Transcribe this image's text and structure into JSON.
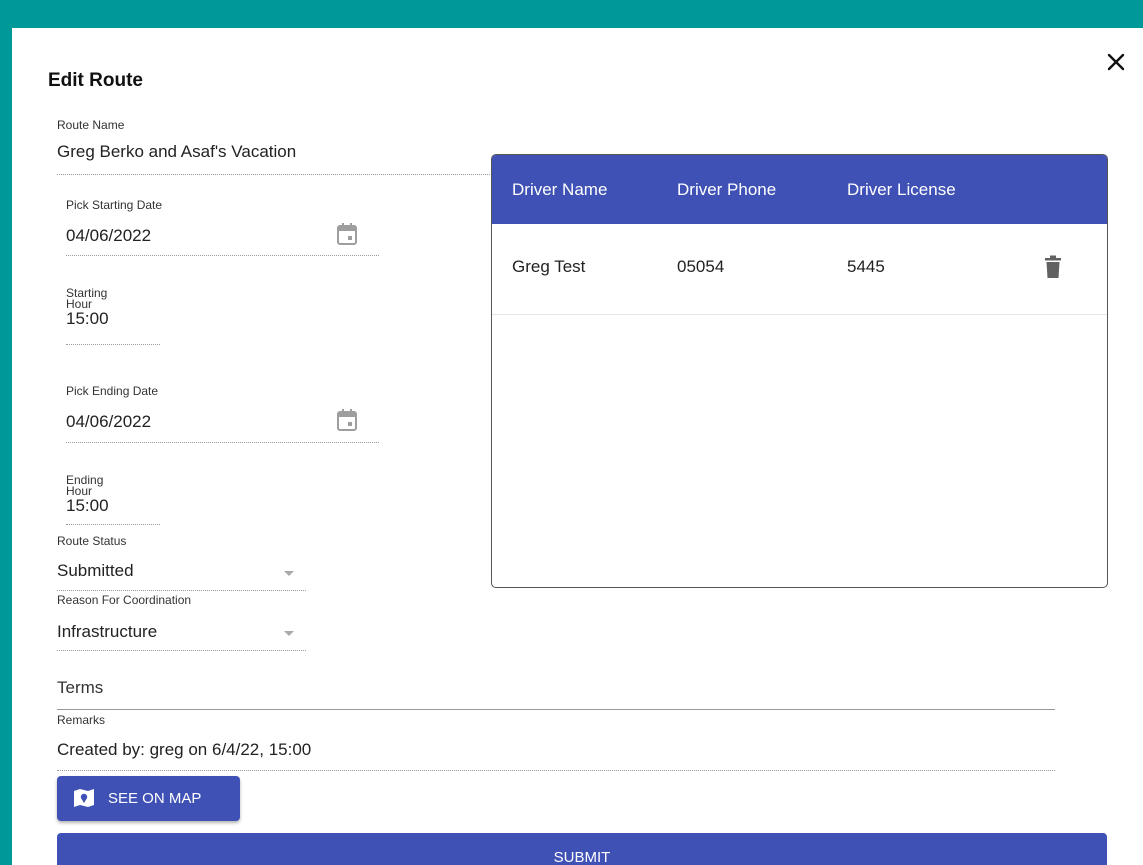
{
  "dialog": {
    "title": "Edit Route"
  },
  "form": {
    "route_name": {
      "label": "Route Name",
      "value": "Greg Berko and Asaf's Vacation"
    },
    "start_date": {
      "label": "Pick Starting Date",
      "value": "04/06/2022"
    },
    "start_hour": {
      "label_line1": "Starting",
      "label_line2": "Hour",
      "value": "15:00"
    },
    "end_date": {
      "label": "Pick Ending Date",
      "value": "04/06/2022"
    },
    "end_hour": {
      "label_line1": "Ending",
      "label_line2": "Hour",
      "value": "15:00"
    },
    "route_status": {
      "label": "Route Status",
      "value": "Submitted"
    },
    "reason": {
      "label": "Reason For Coordination",
      "value": "Infrastructure"
    },
    "terms": {
      "placeholder": "Terms"
    },
    "remarks": {
      "label": "Remarks",
      "value": "Created by: greg on 6/4/22, 15:00"
    }
  },
  "drivers_table": {
    "columns": [
      "Driver Name",
      "Driver Phone",
      "Driver License"
    ],
    "rows": [
      {
        "name": "Greg Test",
        "phone": "05054",
        "license": "5445"
      }
    ]
  },
  "buttons": {
    "see_on_map": "SEE ON MAP",
    "submit": "SUBMIT"
  },
  "colors": {
    "background": "#009999",
    "primary": "#3f51b5",
    "icon_gray": "#616161"
  },
  "icons": {
    "close": "close-icon",
    "calendar": "calendar-icon",
    "dropdown": "chevron-down-icon",
    "delete": "trash-icon",
    "map": "map-icon"
  }
}
